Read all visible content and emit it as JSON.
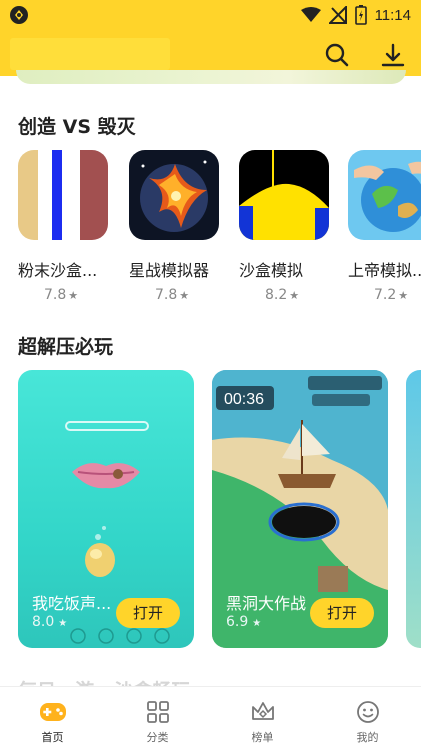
{
  "status_bar": {
    "time": "11:14"
  },
  "header": {
    "search_icon": "search-icon",
    "download_icon": "download-icon"
  },
  "sections": [
    {
      "title": "创造 VS 毁灭",
      "apps": [
        {
          "name": "粉末沙盒...",
          "rating": "7.8"
        },
        {
          "name": "星战模拟器",
          "rating": "7.8"
        },
        {
          "name": "沙盒模拟",
          "rating": "8.2"
        },
        {
          "name": "上帝模拟...",
          "rating": "7.2"
        }
      ]
    },
    {
      "title": "超解压必玩",
      "cards": [
        {
          "title": "我吃饭声...",
          "score": "8.0",
          "button": "打开"
        },
        {
          "title": "黑洞大作战",
          "score": "6.9",
          "button": "打开",
          "timer": "00:36"
        }
      ]
    }
  ],
  "next_section_title": "每日一游 · 沙盒畅玩",
  "bottom_nav": [
    {
      "label": "首页",
      "icon": "home-gamepad-icon",
      "active": true
    },
    {
      "label": "分类",
      "icon": "grid-icon",
      "active": false
    },
    {
      "label": "榜单",
      "icon": "crown-icon",
      "active": false
    },
    {
      "label": "我的",
      "icon": "face-icon",
      "active": false
    }
  ],
  "colors": {
    "accent": "#ffd42a",
    "card_teal": "#3fd9cf"
  }
}
